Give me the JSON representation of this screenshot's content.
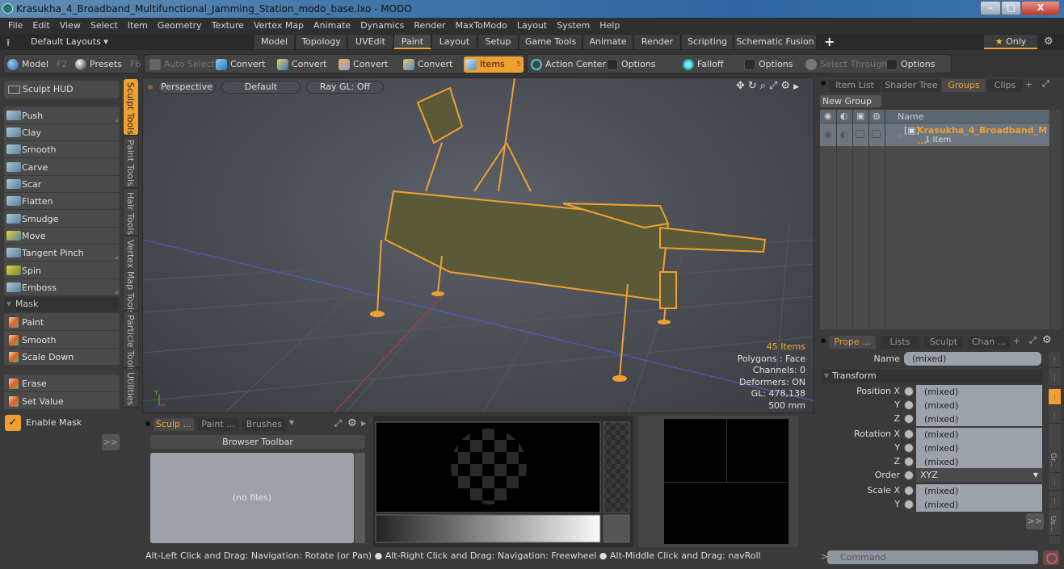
{
  "window": {
    "title": "Krasukha_4_Broadband_Multifunctional_Jamming_Station_modo_base.lxo - MODO",
    "minimize": "–",
    "maximize": "□",
    "close": "X"
  },
  "menu": [
    "File",
    "Edit",
    "View",
    "Select",
    "Item",
    "Geometry",
    "Texture",
    "Vertex Map",
    "Animate",
    "Dynamics",
    "Render",
    "MaxToModo",
    "Layout",
    "System",
    "Help"
  ],
  "layout_bar": {
    "default_layouts": "Default Layouts ▾",
    "tabs": [
      "Model",
      "Topology",
      "UVEdit",
      "Paint",
      "Layout",
      "Setup",
      "Game Tools",
      "Animate",
      "Render",
      "Scripting",
      "Schematic Fusion"
    ],
    "active_tab": "Paint",
    "plus": "+",
    "only_label": "Only",
    "star": "★"
  },
  "toolrow": {
    "model": "Model",
    "model_key": "F2",
    "presets": "Presets",
    "presets_key": "F6",
    "auto_select": "Auto Select",
    "convert": "Convert",
    "items": "Items",
    "items_key": "5",
    "action_center": "Action Center",
    "options": "Options",
    "falloff": "Falloff",
    "select_through": "Select Through"
  },
  "left_panel": {
    "sculpt_hud": "Sculpt HUD",
    "sculpt_tools": [
      "Push",
      "Clay",
      "Smooth",
      "Carve",
      "Scar",
      "Flatten",
      "Smudge",
      "Move",
      "Tangent Pinch",
      "Spin",
      "Emboss"
    ],
    "mask_header": "Mask",
    "mask_tools": [
      "Paint",
      "Smooth",
      "Scale Down"
    ],
    "mask_tools2": [
      "Erase",
      "Set Value"
    ],
    "enable_mask": "Enable Mask",
    "enable_mask_checked": true,
    "more": ">>"
  },
  "vertical_tabs": [
    "Sculpt Tools",
    "Paint Tools",
    "Hair Tools",
    "Vertex Map Tools",
    "Particle Tools",
    "Utilities"
  ],
  "viewport": {
    "view": "Perspective",
    "shading": "Default",
    "raygl": "Ray GL: Off",
    "stats": {
      "items": "45 Items",
      "polygons": "Polygons : Face",
      "channels": "Channels: 0",
      "deformers": "Deformers: ON",
      "gl": "GL: 478,138",
      "scale": "500 mm"
    },
    "axis_label": "Y"
  },
  "groups_panel": {
    "tabs": [
      "Item List",
      "Shader Tree",
      "Groups",
      "Clips"
    ],
    "active_tab": "Groups",
    "new_group": "New Group",
    "column_name": "Name",
    "row": {
      "name": "Krasukha_4_Broadband_M ...",
      "sub": "1 Item"
    }
  },
  "properties": {
    "tabs": [
      "Prope ...",
      "Lists",
      "Sculpt",
      "Chan ..."
    ],
    "active_tab": "Prope ...",
    "name_label": "Name",
    "name_value": "(mixed)",
    "transform_header": "Transform",
    "rows": [
      {
        "label": "Position X",
        "value": "(mixed)"
      },
      {
        "label": "Y",
        "value": "(mixed)"
      },
      {
        "label": "Z",
        "value": "(mixed)"
      },
      {
        "label": "Rotation X",
        "value": "(mixed)"
      },
      {
        "label": "Y",
        "value": "(mixed)"
      },
      {
        "label": "Z",
        "value": "(mixed)"
      },
      {
        "label": "Scale X",
        "value": "(mixed)"
      },
      {
        "label": "Y",
        "value": "(mixed)"
      }
    ],
    "order_label": "Order",
    "order_value": "XYZ",
    "more": ">>",
    "side_tabs": [
      "⋮",
      "⋮",
      "⋮",
      "⋮",
      "Gr...",
      "⋮",
      "⋮",
      "Us..."
    ]
  },
  "browser": {
    "tabs": [
      "Sculp ...",
      "Paint ...",
      "Brushes"
    ],
    "active_tab": "Sculp ...",
    "toolbar": "Browser Toolbar",
    "empty": "(no files)"
  },
  "status": {
    "hint": "Alt-Left Click and Drag: Navigation: Rotate (or Pan) ● Alt-Right Click and Drag: Navigation: Freewheel ● Alt-Middle Click and Drag: navRoll"
  },
  "command": {
    "prompt": ">",
    "placeholder": "Command"
  },
  "colors": {
    "accent": "#f0a030",
    "wireframe": "#f0a030"
  }
}
